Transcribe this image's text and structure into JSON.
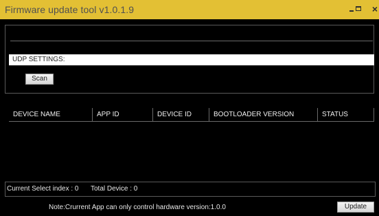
{
  "window": {
    "title": "Firmware update tool v1.0.1.9",
    "controls": {
      "minimize": "–",
      "maximize": "□",
      "close": "×"
    }
  },
  "udp": {
    "label": "UDP SETTINGS:",
    "scan_label": "Scan"
  },
  "table": {
    "columns": [
      "DEVICE NAME",
      "APP ID",
      "DEVICE ID",
      "BOOTLOADER VERSION",
      "STATUS"
    ],
    "rows": []
  },
  "status": {
    "current_select": "Current Select index :  0",
    "total_device": "Total Device :  0"
  },
  "footer": {
    "note": "Note:Crurrent App can only control hardware version:1.0.0",
    "update_label": "Update"
  },
  "colors": {
    "titlebar": "#e3c034",
    "background": "#000000"
  }
}
